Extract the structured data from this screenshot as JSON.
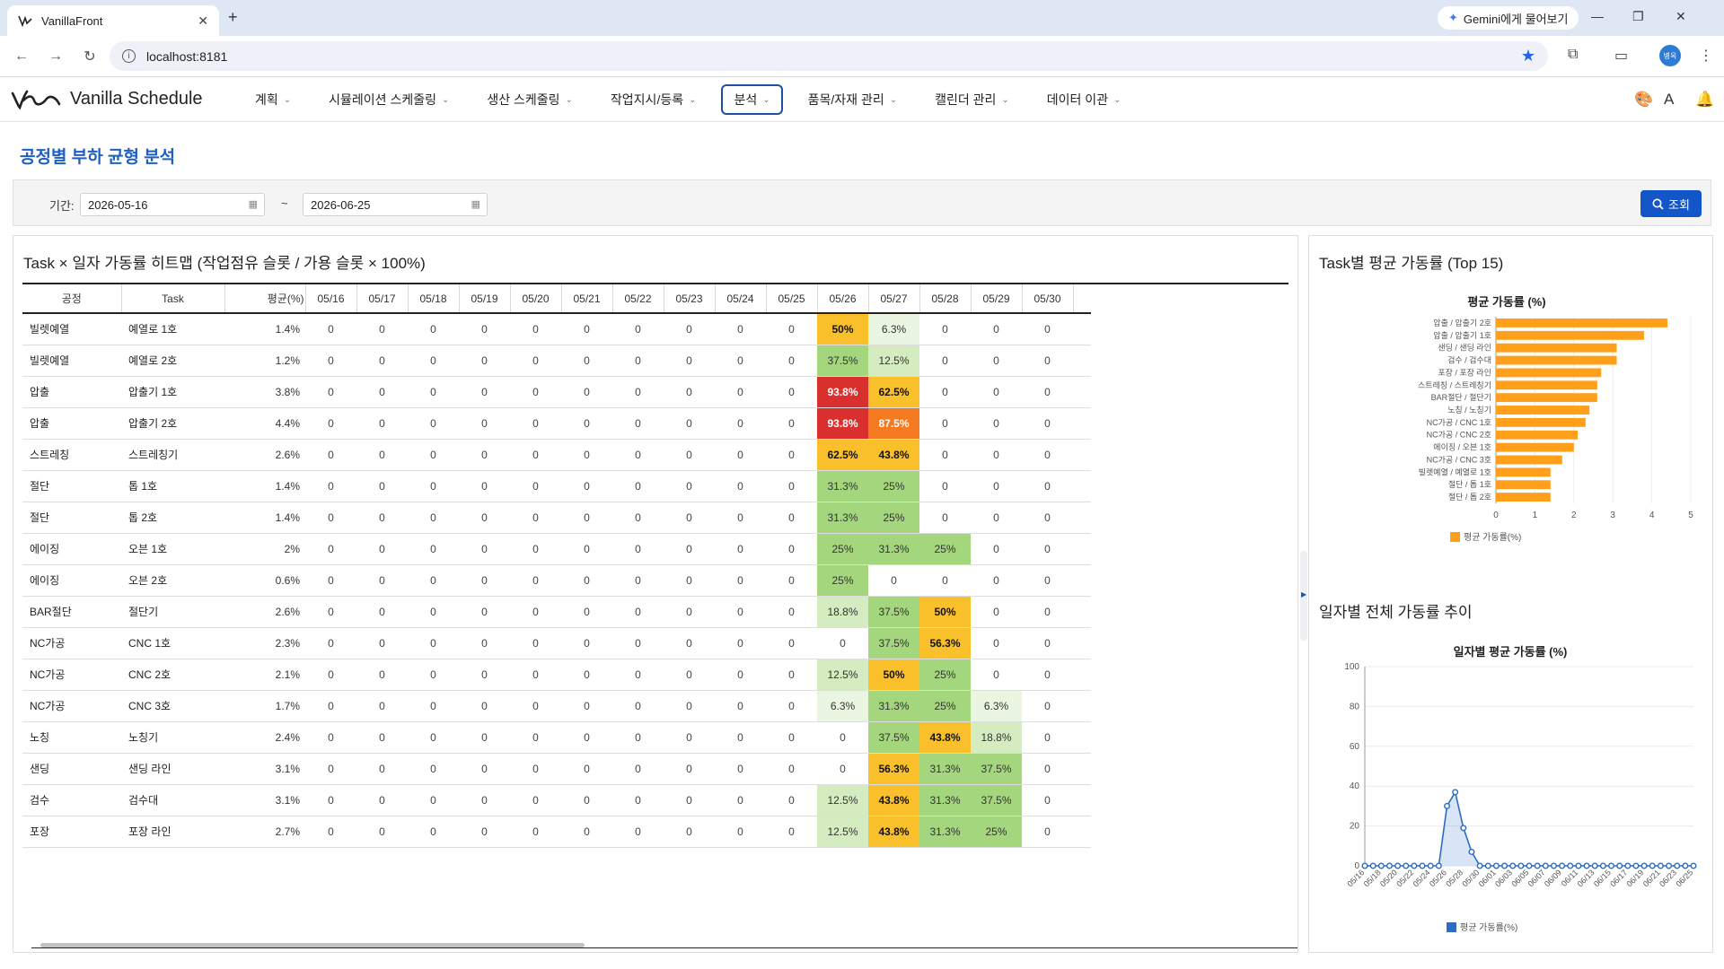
{
  "browser": {
    "tab_title": "VanillaFront",
    "url": "localhost:8181",
    "gemini_label": "Gemini에게 물어보기",
    "avatar_text": "병옥"
  },
  "app": {
    "brand": "Vanilla Schedule",
    "menu": [
      {
        "label": "계획",
        "active": false
      },
      {
        "label": "시뮬레이션 스케줄링",
        "active": false
      },
      {
        "label": "생산 스케줄링",
        "active": false
      },
      {
        "label": "작업지시/등록",
        "active": false
      },
      {
        "label": "분석",
        "active": true
      },
      {
        "label": "품목/자재 관리",
        "active": false
      },
      {
        "label": "캘린더 관리",
        "active": false
      },
      {
        "label": "데이터 이관",
        "active": false
      }
    ]
  },
  "page": {
    "title": "공정별 부하 균형 분석",
    "period_label": "기간:",
    "start_date": "2026-05-16",
    "tilde": "~",
    "end_date": "2026-06-25",
    "search_label": "조회"
  },
  "heatmap": {
    "title": "Task × 일자 가동률 히트맵 (작업점유 슬롯 / 가용 슬롯 × 100%)",
    "columns": [
      "공정",
      "Task",
      "평균(%)",
      "05/16",
      "05/17",
      "05/18",
      "05/19",
      "05/20",
      "05/21",
      "05/22",
      "05/23",
      "05/24",
      "05/25",
      "05/26",
      "05/27",
      "05/28",
      "05/29",
      "05/30"
    ],
    "rows": [
      {
        "process": "빌렛예열",
        "task": "예열로 1호",
        "avg": "1.4%",
        "cells": [
          "0",
          "0",
          "0",
          "0",
          "0",
          "0",
          "0",
          "0",
          "0",
          "0",
          "50%",
          "6.3%",
          "0",
          "0",
          "0"
        ]
      },
      {
        "process": "빌렛예열",
        "task": "예열로 2호",
        "avg": "1.2%",
        "cells": [
          "0",
          "0",
          "0",
          "0",
          "0",
          "0",
          "0",
          "0",
          "0",
          "0",
          "37.5%",
          "12.5%",
          "0",
          "0",
          "0"
        ]
      },
      {
        "process": "압출",
        "task": "압출기 1호",
        "avg": "3.8%",
        "cells": [
          "0",
          "0",
          "0",
          "0",
          "0",
          "0",
          "0",
          "0",
          "0",
          "0",
          "93.8%",
          "62.5%",
          "0",
          "0",
          "0"
        ]
      },
      {
        "process": "압출",
        "task": "압출기 2호",
        "avg": "4.4%",
        "cells": [
          "0",
          "0",
          "0",
          "0",
          "0",
          "0",
          "0",
          "0",
          "0",
          "0",
          "93.8%",
          "87.5%",
          "0",
          "0",
          "0"
        ]
      },
      {
        "process": "스트레칭",
        "task": "스트레칭기",
        "avg": "2.6%",
        "cells": [
          "0",
          "0",
          "0",
          "0",
          "0",
          "0",
          "0",
          "0",
          "0",
          "0",
          "62.5%",
          "43.8%",
          "0",
          "0",
          "0"
        ]
      },
      {
        "process": "절단",
        "task": "톱 1호",
        "avg": "1.4%",
        "cells": [
          "0",
          "0",
          "0",
          "0",
          "0",
          "0",
          "0",
          "0",
          "0",
          "0",
          "31.3%",
          "25%",
          "0",
          "0",
          "0"
        ]
      },
      {
        "process": "절단",
        "task": "톱 2호",
        "avg": "1.4%",
        "cells": [
          "0",
          "0",
          "0",
          "0",
          "0",
          "0",
          "0",
          "0",
          "0",
          "0",
          "31.3%",
          "25%",
          "0",
          "0",
          "0"
        ]
      },
      {
        "process": "에이징",
        "task": "오븐 1호",
        "avg": "2%",
        "cells": [
          "0",
          "0",
          "0",
          "0",
          "0",
          "0",
          "0",
          "0",
          "0",
          "0",
          "25%",
          "31.3%",
          "25%",
          "0",
          "0"
        ]
      },
      {
        "process": "에이징",
        "task": "오븐 2호",
        "avg": "0.6%",
        "cells": [
          "0",
          "0",
          "0",
          "0",
          "0",
          "0",
          "0",
          "0",
          "0",
          "0",
          "25%",
          "0",
          "0",
          "0",
          "0"
        ]
      },
      {
        "process": "BAR절단",
        "task": "절단기",
        "avg": "2.6%",
        "cells": [
          "0",
          "0",
          "0",
          "0",
          "0",
          "0",
          "0",
          "0",
          "0",
          "0",
          "18.8%",
          "37.5%",
          "50%",
          "0",
          "0"
        ]
      },
      {
        "process": "NC가공",
        "task": "CNC 1호",
        "avg": "2.3%",
        "cells": [
          "0",
          "0",
          "0",
          "0",
          "0",
          "0",
          "0",
          "0",
          "0",
          "0",
          "0",
          "37.5%",
          "56.3%",
          "0",
          "0"
        ]
      },
      {
        "process": "NC가공",
        "task": "CNC 2호",
        "avg": "2.1%",
        "cells": [
          "0",
          "0",
          "0",
          "0",
          "0",
          "0",
          "0",
          "0",
          "0",
          "0",
          "12.5%",
          "50%",
          "25%",
          "0",
          "0"
        ]
      },
      {
        "process": "NC가공",
        "task": "CNC 3호",
        "avg": "1.7%",
        "cells": [
          "0",
          "0",
          "0",
          "0",
          "0",
          "0",
          "0",
          "0",
          "0",
          "0",
          "6.3%",
          "31.3%",
          "25%",
          "6.3%",
          "0"
        ]
      },
      {
        "process": "노칭",
        "task": "노칭기",
        "avg": "2.4%",
        "cells": [
          "0",
          "0",
          "0",
          "0",
          "0",
          "0",
          "0",
          "0",
          "0",
          "0",
          "0",
          "37.5%",
          "43.8%",
          "18.8%",
          "0"
        ]
      },
      {
        "process": "샌딩",
        "task": "샌딩 라인",
        "avg": "3.1%",
        "cells": [
          "0",
          "0",
          "0",
          "0",
          "0",
          "0",
          "0",
          "0",
          "0",
          "0",
          "0",
          "56.3%",
          "31.3%",
          "37.5%",
          "0"
        ]
      },
      {
        "process": "검수",
        "task": "검수대",
        "avg": "3.1%",
        "cells": [
          "0",
          "0",
          "0",
          "0",
          "0",
          "0",
          "0",
          "0",
          "0",
          "0",
          "12.5%",
          "43.8%",
          "31.3%",
          "37.5%",
          "0"
        ]
      },
      {
        "process": "포장",
        "task": "포장 라인",
        "avg": "2.7%",
        "cells": [
          "0",
          "0",
          "0",
          "0",
          "0",
          "0",
          "0",
          "0",
          "0",
          "0",
          "12.5%",
          "43.8%",
          "31.3%",
          "25%",
          "0"
        ]
      }
    ]
  },
  "right_panel": {
    "bar_section_title": "Task별 평균 가동률 (Top 15)",
    "line_section_title": "일자별 전체 가동률 추이"
  },
  "chart_data": [
    {
      "type": "bar",
      "orientation": "horizontal",
      "title": "평균 가동률 (%)",
      "categories": [
        "압출 / 압출기 2호",
        "압출 / 압출기 1호",
        "샌딩 / 샌딩 라인",
        "검수 / 검수대",
        "포장 / 포장 라인",
        "스트레칭 / 스트레칭기",
        "BAR절단 / 절단기",
        "노칭 / 노칭기",
        "NC가공 / CNC 1호",
        "NC가공 / CNC 2호",
        "에이징 / 오븐 1호",
        "NC가공 / CNC 3호",
        "빌렛예열 / 예열로 1호",
        "절단 / 톱 1호",
        "절단 / 톱 2호"
      ],
      "series": [
        {
          "name": "평균 가동률(%)",
          "values": [
            4.4,
            3.8,
            3.1,
            3.1,
            2.7,
            2.6,
            2.6,
            2.4,
            2.3,
            2.1,
            2.0,
            1.7,
            1.4,
            1.4,
            1.4
          ]
        }
      ],
      "xlim": [
        0,
        5
      ],
      "xticks": [
        "0",
        "1",
        "2",
        "3",
        "4",
        "5"
      ],
      "color": "#ff9f1a",
      "legend": "bottom"
    },
    {
      "type": "area",
      "title": "일자별 평균 가동률 (%)",
      "x": [
        "05/16",
        "05/17",
        "05/18",
        "05/19",
        "05/20",
        "05/21",
        "05/22",
        "05/23",
        "05/24",
        "05/25",
        "05/26",
        "05/27",
        "05/28",
        "05/29",
        "05/30",
        "05/31",
        "06/01",
        "06/02",
        "06/03",
        "06/04",
        "06/05",
        "06/06",
        "06/07",
        "06/08",
        "06/09",
        "06/10",
        "06/11",
        "06/12",
        "06/13",
        "06/14",
        "06/15",
        "06/16",
        "06/17",
        "06/18",
        "06/19",
        "06/20",
        "06/21",
        "06/22",
        "06/23",
        "06/24",
        "06/25"
      ],
      "xtick_labels": [
        "05/16",
        "05/18",
        "05/20",
        "05/22",
        "05/24",
        "05/26",
        "05/28",
        "05/30",
        "06/01",
        "06/03",
        "06/05",
        "06/07",
        "06/09",
        "06/11",
        "06/13",
        "06/15",
        "06/17",
        "06/19",
        "06/21",
        "06/23",
        "06/25"
      ],
      "series": [
        {
          "name": "평균 가동률(%)",
          "values": [
            0,
            0,
            0,
            0,
            0,
            0,
            0,
            0,
            0,
            0,
            30,
            37,
            19,
            7,
            0,
            0,
            0,
            0,
            0,
            0,
            0,
            0,
            0,
            0,
            0,
            0,
            0,
            0,
            0,
            0,
            0,
            0,
            0,
            0,
            0,
            0,
            0,
            0,
            0,
            0,
            0
          ]
        }
      ],
      "ylim": [
        0,
        100
      ],
      "yticks": [
        "0",
        "20",
        "40",
        "60",
        "80",
        "100"
      ],
      "color": "#2b6cc4",
      "legend": "bottom"
    }
  ]
}
